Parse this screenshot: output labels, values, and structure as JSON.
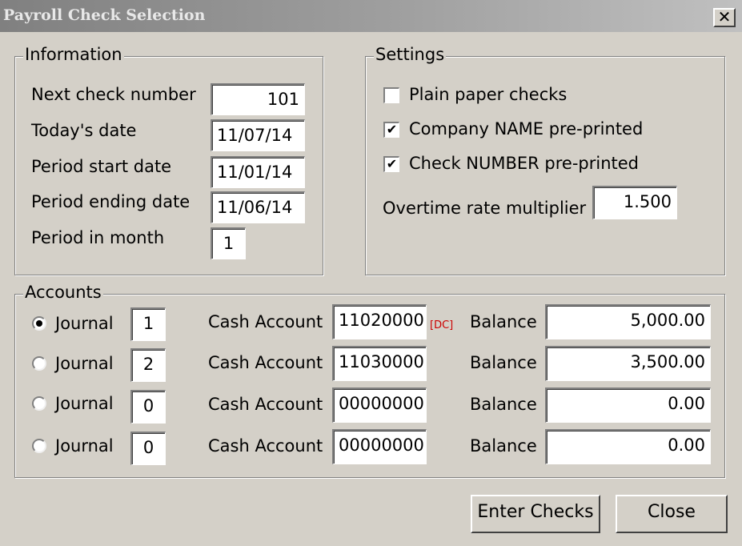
{
  "window": {
    "title": "Payroll Check Selection",
    "close_glyph": "✕"
  },
  "information": {
    "legend": "Information",
    "next_check_label": "Next check number",
    "next_check_value": "101",
    "todays_date_label": "Today's date",
    "todays_date_value": "11/07/14",
    "period_start_label": "Period start date",
    "period_start_value": "11/01/14",
    "period_end_label": "Period ending date",
    "period_end_value": "11/06/14",
    "period_in_month_label": "Period in month",
    "period_in_month_value": "1"
  },
  "settings": {
    "legend": "Settings",
    "plain_paper_label": "Plain paper checks",
    "plain_paper_checked": false,
    "company_name_label": "Company NAME pre-printed",
    "company_name_checked": true,
    "check_number_label": "Check NUMBER pre-printed",
    "check_number_checked": true,
    "overtime_label": "Overtime rate multiplier",
    "overtime_value": "1.500"
  },
  "accounts": {
    "legend": "Accounts",
    "journal_label": "Journal",
    "cash_account_label": "Cash Account",
    "balance_label": "Balance",
    "dc_tag": "[DC]",
    "rows": [
      {
        "selected": true,
        "journal": "1",
        "cash_account": "11020000",
        "balance": "5,000.00"
      },
      {
        "selected": false,
        "journal": "2",
        "cash_account": "11030000",
        "balance": "3,500.00"
      },
      {
        "selected": false,
        "journal": "0",
        "cash_account": "00000000",
        "balance": "0.00"
      },
      {
        "selected": false,
        "journal": "0",
        "cash_account": "00000000",
        "balance": "0.00"
      }
    ]
  },
  "buttons": {
    "enter_checks": "Enter Checks",
    "close": "Close"
  },
  "icons": {
    "check_mark": "✔"
  }
}
